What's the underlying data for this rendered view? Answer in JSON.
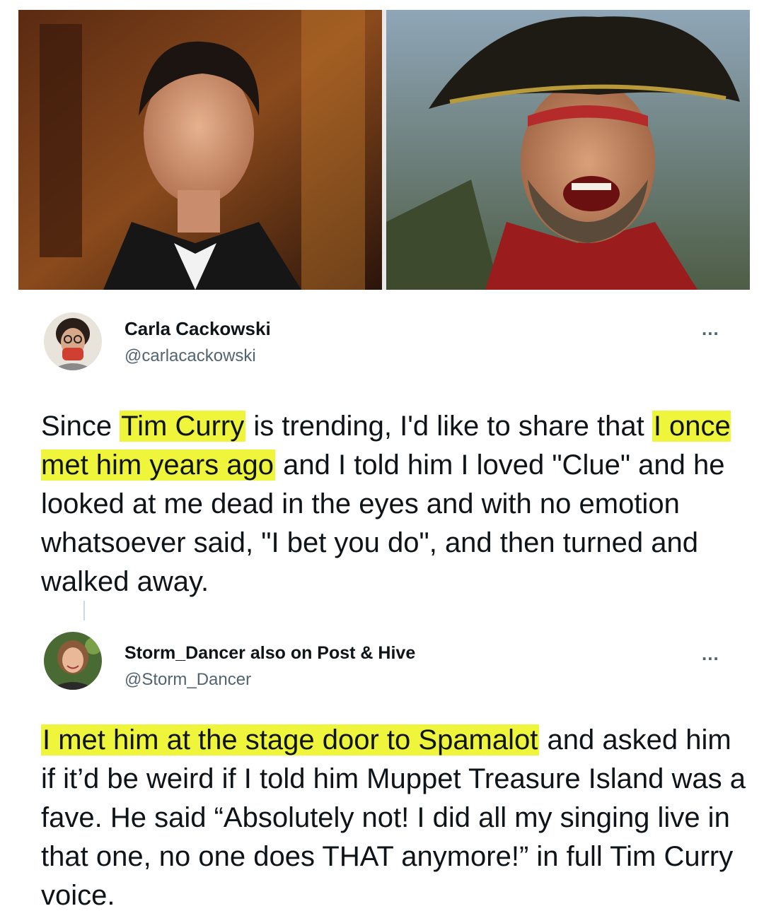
{
  "tweet1": {
    "name": "Carla Cackowski",
    "handle": "@carlacackowski",
    "more": "...",
    "text": {
      "p1": "Since ",
      "h1": "Tim Curry",
      "p2": " is trending, I'd like to share that ",
      "h2": "I once met him years ago",
      "p3": " and I told him I loved \"Clue\" and he looked at me dead in the eyes and with no emotion whatsoever said, \"I bet you do\", and then turned and walked away."
    }
  },
  "tweet2": {
    "name": "Storm_Dancer also on Post & Hive",
    "handle": "@Storm_Dancer",
    "more": "...",
    "text": {
      "h1": "I met him at the stage door to Spamalot",
      "p1": " and asked him if it’d be weird if I told him Muppet Treasure Island was a fave. He said “Absolutely not! I did all my singing live in that one,  no one does THAT anymore!” in full Tim Curry voice."
    }
  },
  "colors": {
    "highlight": "#eef53a",
    "handle": "#536471",
    "text": "#0f1419"
  }
}
